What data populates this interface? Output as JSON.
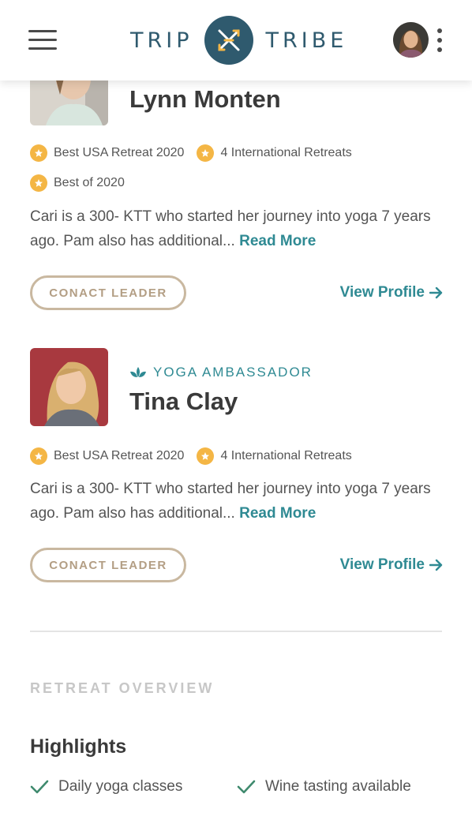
{
  "header": {
    "logo_left": "TRIP",
    "logo_right": "TRIBE"
  },
  "leaders": [
    {
      "role": "",
      "name": "Lynn Monten",
      "badges": [
        "Best USA Retreat 2020",
        "4 International Retreats",
        "Best of 2020"
      ],
      "bio": "Cari is a 300- KTT who started her journey into yoga 7 years ago. Pam also has additional...",
      "read_more": "Read More",
      "contact_label": "CONACT LEADER",
      "view_profile_label": "View Profile"
    },
    {
      "role": "YOGA AMBASSADOR",
      "name": "Tina Clay",
      "badges": [
        "Best USA Retreat 2020",
        "4 International Retreats"
      ],
      "bio": "Cari is a 300- KTT who started her journey into yoga 7 years ago. Pam also has additional...",
      "read_more": "Read More",
      "contact_label": "CONACT LEADER",
      "view_profile_label": "View Profile"
    }
  ],
  "overview": {
    "section_label": "RETREAT OVERVIEW",
    "highlights_title": "Highlights",
    "highlights": [
      "Daily yoga classes",
      "Wine tasting available"
    ]
  },
  "colors": {
    "brand": "#2f5a6e",
    "teal": "#2f8a93",
    "star": "#f4b645",
    "button_border": "#c9b8a0"
  }
}
